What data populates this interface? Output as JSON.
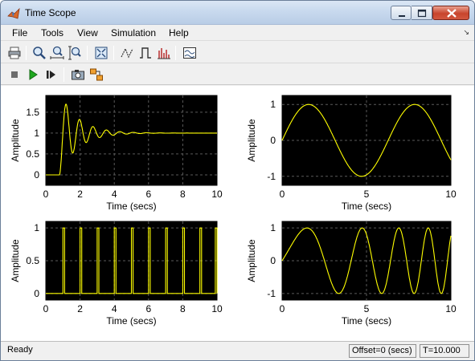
{
  "window": {
    "title": "Time Scope"
  },
  "menu": {
    "items": [
      "File",
      "Tools",
      "View",
      "Simulation",
      "Help"
    ]
  },
  "toolbar": {
    "icons": [
      "print-icon",
      "zoom-in-icon",
      "zoom-x-icon",
      "zoom-y-icon",
      "autoscale-icon",
      "trigger-icon",
      "signal-icon",
      "measurements-icon",
      "layout-icon"
    ],
    "sim_icons": [
      "stop-icon",
      "run-icon",
      "step-forward-icon",
      "snapshot-icon",
      "highlight-block-icon"
    ]
  },
  "status": {
    "text": "Ready",
    "offset": "Offset=0 (secs)",
    "time": "T=10.000"
  },
  "colors": {
    "signal": "#ffff00",
    "axes_bg": "#000000",
    "grid": "#5a5a5a"
  },
  "chart_data": [
    {
      "type": "line",
      "panel": "top-left",
      "xlabel": "Time (secs)",
      "ylabel": "Amplitude",
      "xlim": [
        0,
        10
      ],
      "ylim": [
        -0.25,
        1.9
      ],
      "xticks": [
        "0",
        "2",
        "4",
        "6",
        "8",
        "10"
      ],
      "yticks": [
        "0",
        "0.5",
        "1",
        "1.5"
      ],
      "ytick_values": [
        0,
        0.5,
        1,
        1.5
      ],
      "signal": "damped step response: 0 until t=0.8, peak ~1.75 at t~1.3, settles to 1 by t~6"
    },
    {
      "type": "line",
      "panel": "top-right",
      "xlabel": "Time (secs)",
      "ylabel": "Amplitude",
      "xlim": [
        0,
        10
      ],
      "ylim": [
        -1.25,
        1.25
      ],
      "xticks": [
        "0",
        "5",
        "10"
      ],
      "yticks": [
        "-1",
        "0",
        "1"
      ],
      "ytick_values": [
        -1,
        0,
        1
      ],
      "signal": "sine wave, amplitude 1, period ~6.3 s"
    },
    {
      "type": "line",
      "panel": "bottom-left",
      "xlabel": "Time (secs)",
      "ylabel": "Amplitude",
      "xlim": [
        0,
        10
      ],
      "ylim": [
        -0.1,
        1.1
      ],
      "xticks": [
        "0",
        "2",
        "4",
        "6",
        "8",
        "10"
      ],
      "yticks": [
        "0",
        "0.5",
        "1"
      ],
      "ytick_values": [
        0,
        0.5,
        1
      ],
      "pulse_edges": [
        [
          1.0,
          1.1
        ],
        [
          2.0,
          2.1
        ],
        [
          3.0,
          3.1
        ],
        [
          4.0,
          4.1
        ],
        [
          5.0,
          5.1
        ],
        [
          6.0,
          6.1
        ],
        [
          7.0,
          7.1
        ],
        [
          8.0,
          8.1
        ],
        [
          9.0,
          9.1
        ],
        [
          9.9,
          10
        ]
      ],
      "signal": "pulse train, amplitude 1, period 1 s"
    },
    {
      "type": "line",
      "panel": "bottom-right",
      "xlabel": "Time (secs)",
      "ylabel": "Amplitude",
      "xlim": [
        0,
        10
      ],
      "ylim": [
        -1.2,
        1.2
      ],
      "xticks": [
        "0",
        "5",
        "10"
      ],
      "yticks": [
        "-1",
        "0",
        "1"
      ],
      "ytick_values": [
        -1,
        0,
        1
      ],
      "signal": "chirp, amplitude 1, frequency increasing over time"
    }
  ]
}
